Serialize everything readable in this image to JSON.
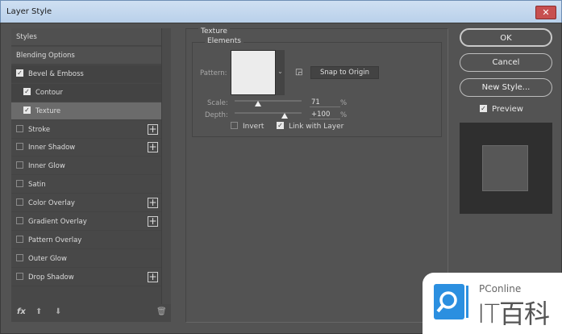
{
  "window": {
    "title": "Layer Style",
    "close": "✕"
  },
  "sidebar": {
    "items": [
      {
        "label": "Styles",
        "checkbox": false,
        "checked": false,
        "plus": false,
        "style": "hd"
      },
      {
        "label": "Blending Options",
        "checkbox": false,
        "checked": false,
        "plus": false,
        "style": "hd"
      },
      {
        "label": "Bevel & Emboss",
        "checkbox": true,
        "checked": true,
        "plus": false,
        "style": "dk"
      },
      {
        "label": "Contour",
        "checkbox": true,
        "checked": true,
        "plus": false,
        "style": "dk",
        "indent": true
      },
      {
        "label": "Texture",
        "checkbox": true,
        "checked": true,
        "plus": false,
        "style": "sel",
        "indent": true
      },
      {
        "label": "Stroke",
        "checkbox": true,
        "checked": false,
        "plus": true
      },
      {
        "label": "Inner Shadow",
        "checkbox": true,
        "checked": false,
        "plus": true
      },
      {
        "label": "Inner Glow",
        "checkbox": true,
        "checked": false,
        "plus": false
      },
      {
        "label": "Satin",
        "checkbox": true,
        "checked": false,
        "plus": false
      },
      {
        "label": "Color Overlay",
        "checkbox": true,
        "checked": false,
        "plus": true
      },
      {
        "label": "Gradient Overlay",
        "checkbox": true,
        "checked": false,
        "plus": true
      },
      {
        "label": "Pattern Overlay",
        "checkbox": true,
        "checked": false,
        "plus": false
      },
      {
        "label": "Outer Glow",
        "checkbox": true,
        "checked": false,
        "plus": false
      },
      {
        "label": "Drop Shadow",
        "checkbox": true,
        "checked": false,
        "plus": true
      }
    ],
    "tools": {
      "fx": "fx",
      "up": "⬆",
      "down": "⬇",
      "trash": "🗑"
    }
  },
  "texture": {
    "group_title": "Texture",
    "elements_title": "Elements",
    "pattern_label": "Pattern:",
    "snap_label": "Snap to Origin",
    "scale_label": "Scale:",
    "scale_value": "71",
    "scale_unit": "%",
    "scale_fraction": 0.35,
    "depth_label": "Depth:",
    "depth_value": "+100",
    "depth_unit": "%",
    "depth_fraction": 0.75,
    "invert_label": "Invert",
    "invert_checked": false,
    "link_label": "Link with Layer",
    "link_checked": true
  },
  "buttons": {
    "ok": "OK",
    "cancel": "Cancel",
    "new_style": "New Style...",
    "preview_label": "Preview",
    "preview_checked": true
  },
  "watermark": {
    "brand": "PConline",
    "name": "IT百科",
    "color": "#2b8fe0"
  }
}
